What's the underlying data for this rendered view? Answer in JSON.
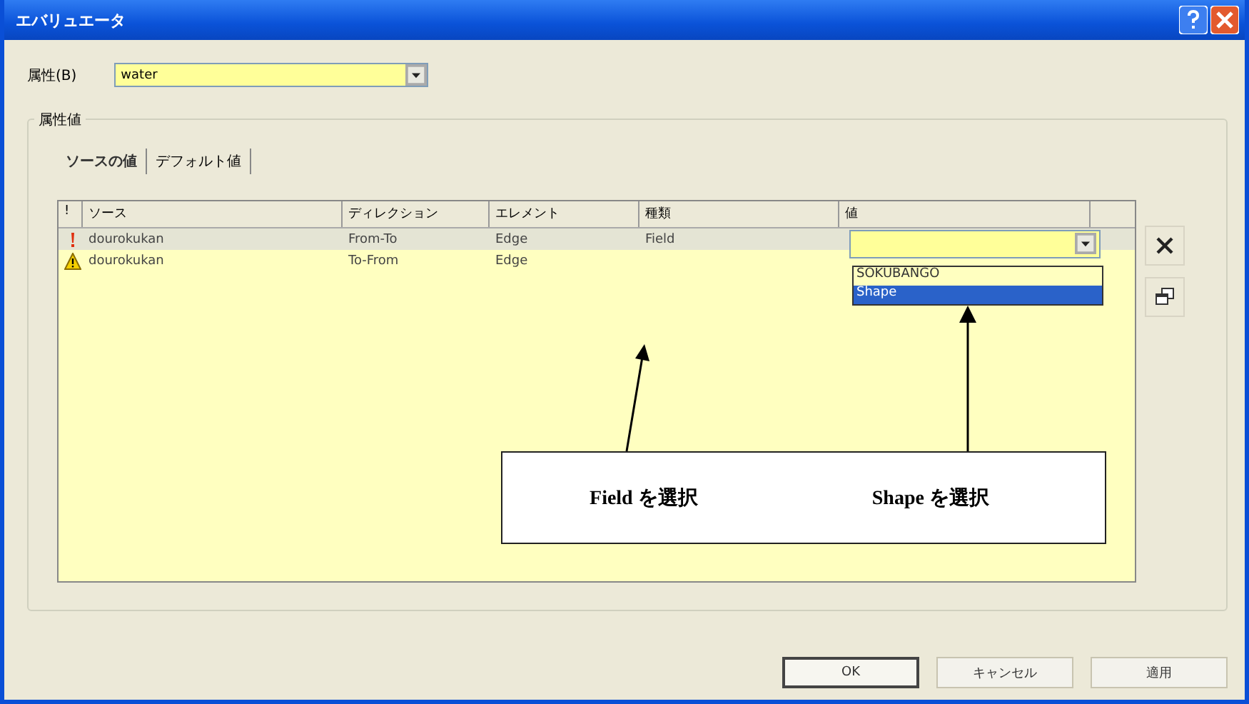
{
  "window": {
    "title": "エバリュエータ"
  },
  "attribute": {
    "label": "属性(B)",
    "value": "water"
  },
  "group": {
    "title": "属性値"
  },
  "tabs": [
    {
      "label": "ソースの値",
      "selected": true
    },
    {
      "label": "デフォルト値",
      "selected": false
    }
  ],
  "table": {
    "columns": [
      "!",
      "ソース",
      "ディレクション",
      "エレメント",
      "種類",
      "値"
    ],
    "rows": [
      {
        "kind": "error",
        "source": "dourokukan",
        "direction": "From-To",
        "element": "Edge",
        "type": "Field",
        "selected": true
      },
      {
        "kind": "warning",
        "source": "dourokukan",
        "direction": "To-From",
        "element": "Edge",
        "selected": false
      }
    ]
  },
  "value_dropdown": {
    "expanded": true,
    "options": [
      {
        "label": "SOKUBANGO",
        "selected": false
      },
      {
        "label": "Shape",
        "selected": true
      }
    ]
  },
  "annotations": [
    {
      "text": "Field を選択"
    },
    {
      "text": "Shape を選択"
    }
  ],
  "buttons": [
    {
      "label": "OK",
      "default": true
    },
    {
      "label": "キャンセル",
      "default": false
    },
    {
      "label": "適用",
      "default": false
    }
  ]
}
